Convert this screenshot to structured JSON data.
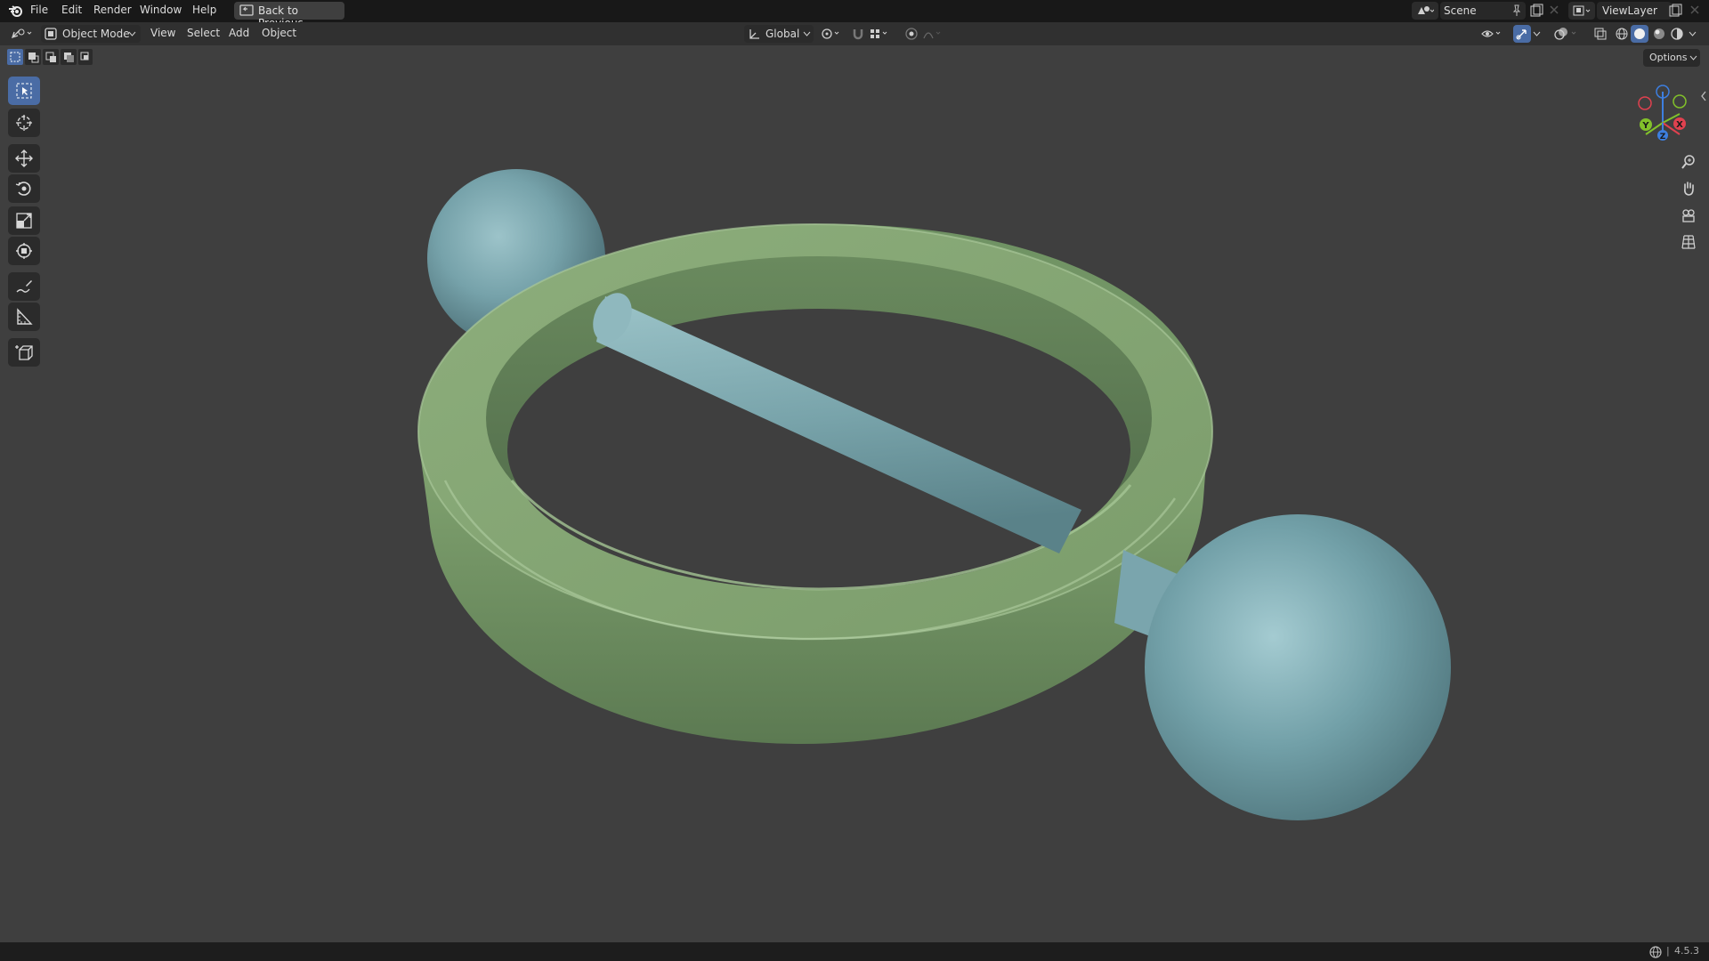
{
  "app": {
    "menu": [
      "File",
      "Edit",
      "Render",
      "Window",
      "Help"
    ],
    "back_button": "Back to Previous",
    "scene_field": "Scene",
    "viewlayer_field": "ViewLayer"
  },
  "header": {
    "mode_label": "Object Mode",
    "menus": [
      "View",
      "Select",
      "Add",
      "Object"
    ],
    "transform_orientation": "Global",
    "options_label": "Options"
  },
  "gizmo": {
    "x_label": "X",
    "y_label": "Y",
    "z_label": "Z",
    "colors": {
      "x": "#e0414f",
      "y": "#82c12a",
      "z": "#3d7fe0"
    }
  },
  "toolbar": {
    "tools": [
      "select-box",
      "cursor",
      "move",
      "rotate",
      "scale",
      "transform",
      "annotate",
      "measure",
      "add-cube"
    ],
    "active_tool": "select-box"
  },
  "viewport": {
    "objects": [
      "torus-ring",
      "cylinder-rod",
      "sphere-left",
      "sphere-right"
    ],
    "colors": {
      "ring": "#7da06d",
      "rod": "#7aa5ad",
      "sphere": "#6f9aa3",
      "background": "#3f3f3f"
    }
  },
  "status": {
    "version": "4.5.3"
  }
}
